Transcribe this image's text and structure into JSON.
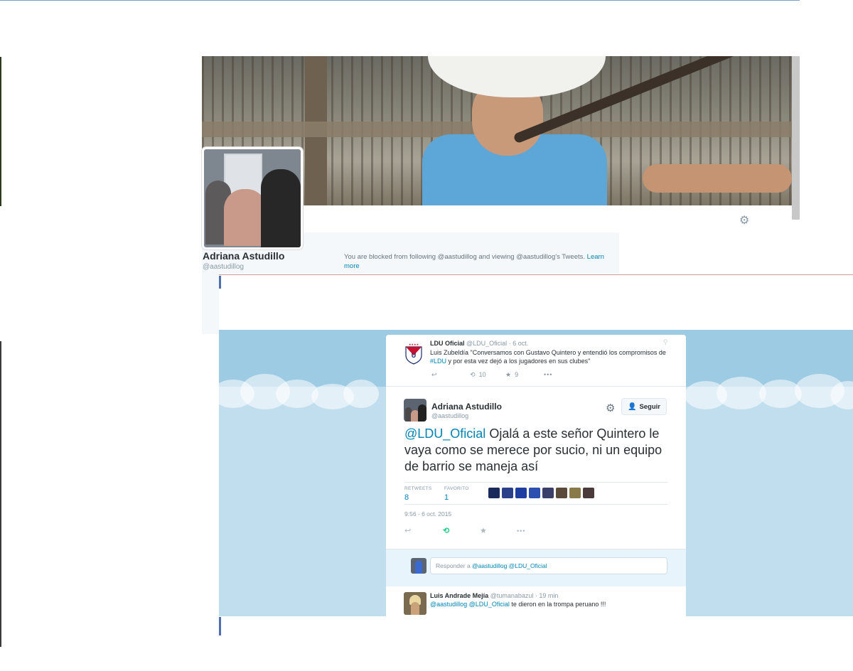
{
  "profile": {
    "name": "Adriana Astudillo",
    "handle": "@aastudillog",
    "blocked_text": "You are blocked from following @aastudillog and viewing @aastudillog's Tweets.",
    "learn_more": "Learn more"
  },
  "tweet_ldu": {
    "name": "LDU Oficial",
    "handle": "@LDU_Oficial",
    "time": "· 6 oct.",
    "text_before": "Luis Zubeldía \"Conversamos con Gustavo Quintero y entendió los compromisos de ",
    "hashtag": "#LDU",
    "text_after": " y por esta vez dejó a los jugadores en sus clubes\"",
    "retweets": "10",
    "favorites": "9"
  },
  "tweet_main": {
    "name": "Adriana Astudillo",
    "handle": "@aastudillog",
    "follow_label": "Seguir",
    "mention": "@LDU_Oficial",
    "text": " Ojalá a este señor Quintero le vaya como se merece por sucio, ni un equipo de barrio se maneja así",
    "retweets_label": "RETWEETS",
    "retweets": "8",
    "favorites_label": "FAVORITO",
    "favorites": "1",
    "timestamp": "9:56 - 6 oct. 2015"
  },
  "reply": {
    "prefix": "Responder a ",
    "mentions": "@aastudillog @LDU_Oficial"
  },
  "tweet_reply": {
    "name": "Luis Andrade Mejía",
    "handle": "@tumanabazul",
    "time": "· 19 min",
    "mentions": "@aastudillog @LDU_Oficial",
    "text": " te dieron en la trompa peruano !!!"
  },
  "colors": {
    "link": "#0084b4",
    "sky": "#c0deed",
    "retweet_active": "#19cf86"
  }
}
